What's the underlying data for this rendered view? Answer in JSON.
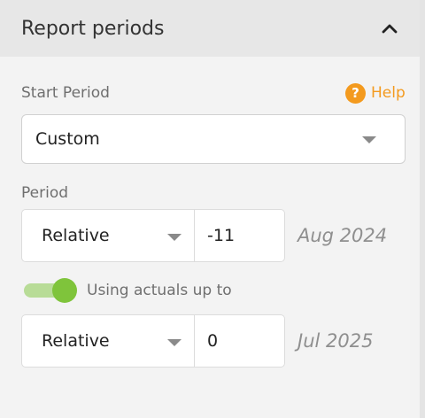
{
  "panel": {
    "title": "Report periods"
  },
  "start_period": {
    "label": "Start Period",
    "help_label": "Help",
    "help_icon_glyph": "?",
    "selected": "Custom"
  },
  "period": {
    "label": "Period",
    "start": {
      "mode": "Relative",
      "offset": "-11",
      "date": "Aug 2024"
    },
    "actuals_toggle": {
      "label": "Using actuals up to",
      "on": true
    },
    "end": {
      "mode": "Relative",
      "offset": "0",
      "date": "Jul 2025"
    }
  },
  "colors": {
    "accent_orange": "#f39a1e",
    "toggle_green": "#7fc43b",
    "header_bg": "#e7e7e7",
    "panel_bg": "#f3f3f3"
  }
}
